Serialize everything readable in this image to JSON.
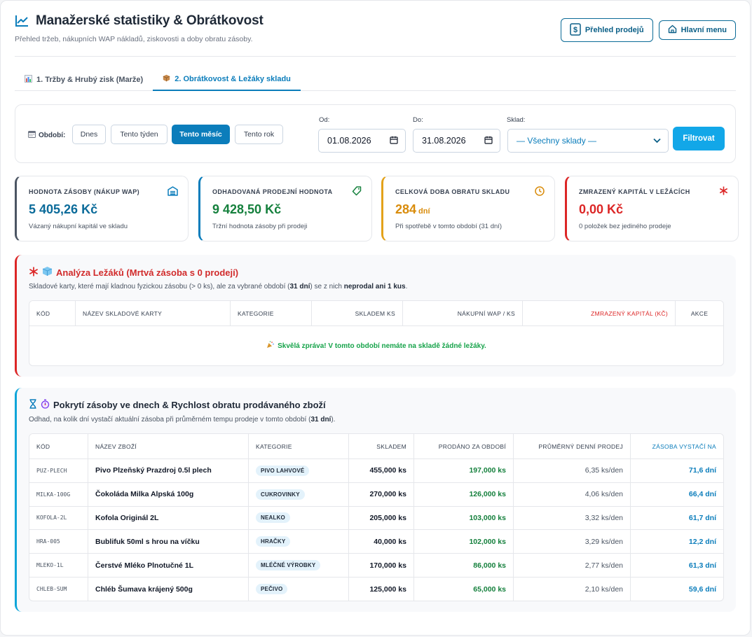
{
  "header": {
    "title": "Manažerské statistiky & Obrátkovost",
    "subtitle": "Přehled tržeb, nákupních WAP nákladů, ziskovosti a doby obratu zásoby.",
    "btn_sales": "Přehled prodejů",
    "btn_menu": "Hlavní menu"
  },
  "tabs": [
    {
      "label": "1. Tržby & Hrubý zisk (Marže)"
    },
    {
      "label": "2. Obrátkovost & Ležáky skladu"
    }
  ],
  "filter": {
    "period_label": "Období:",
    "buttons": [
      "Dnes",
      "Tento týden",
      "Tento měsíc",
      "Tento rok"
    ],
    "from_label": "Od:",
    "from_value": "01.08.2026",
    "to_label": "Do:",
    "to_value": "31.08.2026",
    "warehouse_label": "Sklad:",
    "warehouse_value": "— Všechny sklady —",
    "submit": "Filtrovat"
  },
  "kpis": [
    {
      "title": "HODNOTA ZÁSOBY (NÁKUP WAP)",
      "value": "5 405,26 Kč",
      "unit": "",
      "desc": "Vázaný nákupní kapitál ve skladu",
      "color": "#0b6b9a",
      "border": "#4b5563"
    },
    {
      "title": "ODHADOVANÁ PRODEJNÍ HODNOTA",
      "value": "9 428,50 Kč",
      "unit": "",
      "desc": "Tržní hodnota zásoby při prodeji",
      "color": "#15803d",
      "border": "#0b7dbb"
    },
    {
      "title": "CELKOVÁ DOBA OBRATU SKLADU",
      "value": "284",
      "unit": "dní",
      "desc": "Při spotřebě v tomto období (31 dní)",
      "color": "#d98c0b",
      "border": "#e3a21a"
    },
    {
      "title": "ZMRAZENÝ KAPITÁL V LEŽÁCÍCH",
      "value": "0,00 Kč",
      "unit": "",
      "desc": "0 položek bez jediného prodeje",
      "color": "#dc2626",
      "border": "#dc2626"
    }
  ],
  "dead_stock": {
    "title": "Analýza Ležáků (Mrtvá zásoba s 0 prodejí)",
    "desc_a": "Skladové karty, které mají kladnou fyzickou zásobu (> 0 ks), ale za vybrané období (",
    "desc_b": "31 dní",
    "desc_c": ") se z nich ",
    "desc_d": "neprodal ani 1 kus",
    "desc_e": ".",
    "columns": [
      "KÓD",
      "NÁZEV SKLADOVÉ KARTY",
      "KATEGORIE",
      "SKLADEM KS",
      "NÁKUPNÍ WAP / KS",
      "ZMRAZENÝ KAPITÁL (KČ)",
      "AKCE"
    ],
    "empty_message": "Skvělá zpráva! V tomto období nemáte na skladě žádné ležáky."
  },
  "coverage": {
    "title": "Pokrytí zásoby ve dnech & Rychlost obratu prodávaného zboží",
    "desc_a": "Odhad, na kolik dní vystačí aktuální zásoba při průměrném tempu prodeje v tomto období (",
    "desc_b": "31 dní",
    "desc_c": ").",
    "columns": [
      "KÓD",
      "NÁZEV ZBOŽÍ",
      "KATEGORIE",
      "SKLADEM",
      "PRODÁNO ZA OBDOBÍ",
      "PRŮMĚRNÝ DENNÍ PRODEJ",
      "ZÁSOBA VYSTAČÍ NA"
    ],
    "rows": [
      {
        "code": "PUZ-PLECH",
        "name": "Pivo Plzeňský Prazdroj 0.5l plech",
        "category": "PIVO LAHVOVÉ",
        "stock": "455,000 ks",
        "sold": "197,000 ks",
        "daily": "6,35 ks/den",
        "cover": "71,6 dní"
      },
      {
        "code": "MILKA-100G",
        "name": "Čokoláda Milka Alpská 100g",
        "category": "CUKROVINKY",
        "stock": "270,000 ks",
        "sold": "126,000 ks",
        "daily": "4,06 ks/den",
        "cover": "66,4 dní"
      },
      {
        "code": "KOFOLA-2L",
        "name": "Kofola Originál 2L",
        "category": "NEALKO",
        "stock": "205,000 ks",
        "sold": "103,000 ks",
        "daily": "3,32 ks/den",
        "cover": "61,7 dní"
      },
      {
        "code": "HRA-005",
        "name": "Bublifuk 50ml s hrou na víčku",
        "category": "HRAČKY",
        "stock": "40,000 ks",
        "sold": "102,000 ks",
        "daily": "3,29 ks/den",
        "cover": "12,2 dní"
      },
      {
        "code": "MLEKO-1L",
        "name": "Čerstvé Mléko Plnotučné 1L",
        "category": "MLÉČNÉ VÝROBKY",
        "stock": "170,000 ks",
        "sold": "86,000 ks",
        "daily": "2,77 ks/den",
        "cover": "61,3 dní"
      },
      {
        "code": "CHLEB-SUM",
        "name": "Chléb Šumava krájený 500g",
        "category": "PEČIVO",
        "stock": "125,000 ks",
        "sold": "65,000 ks",
        "daily": "2,10 ks/den",
        "cover": "59,6 dní"
      }
    ]
  }
}
